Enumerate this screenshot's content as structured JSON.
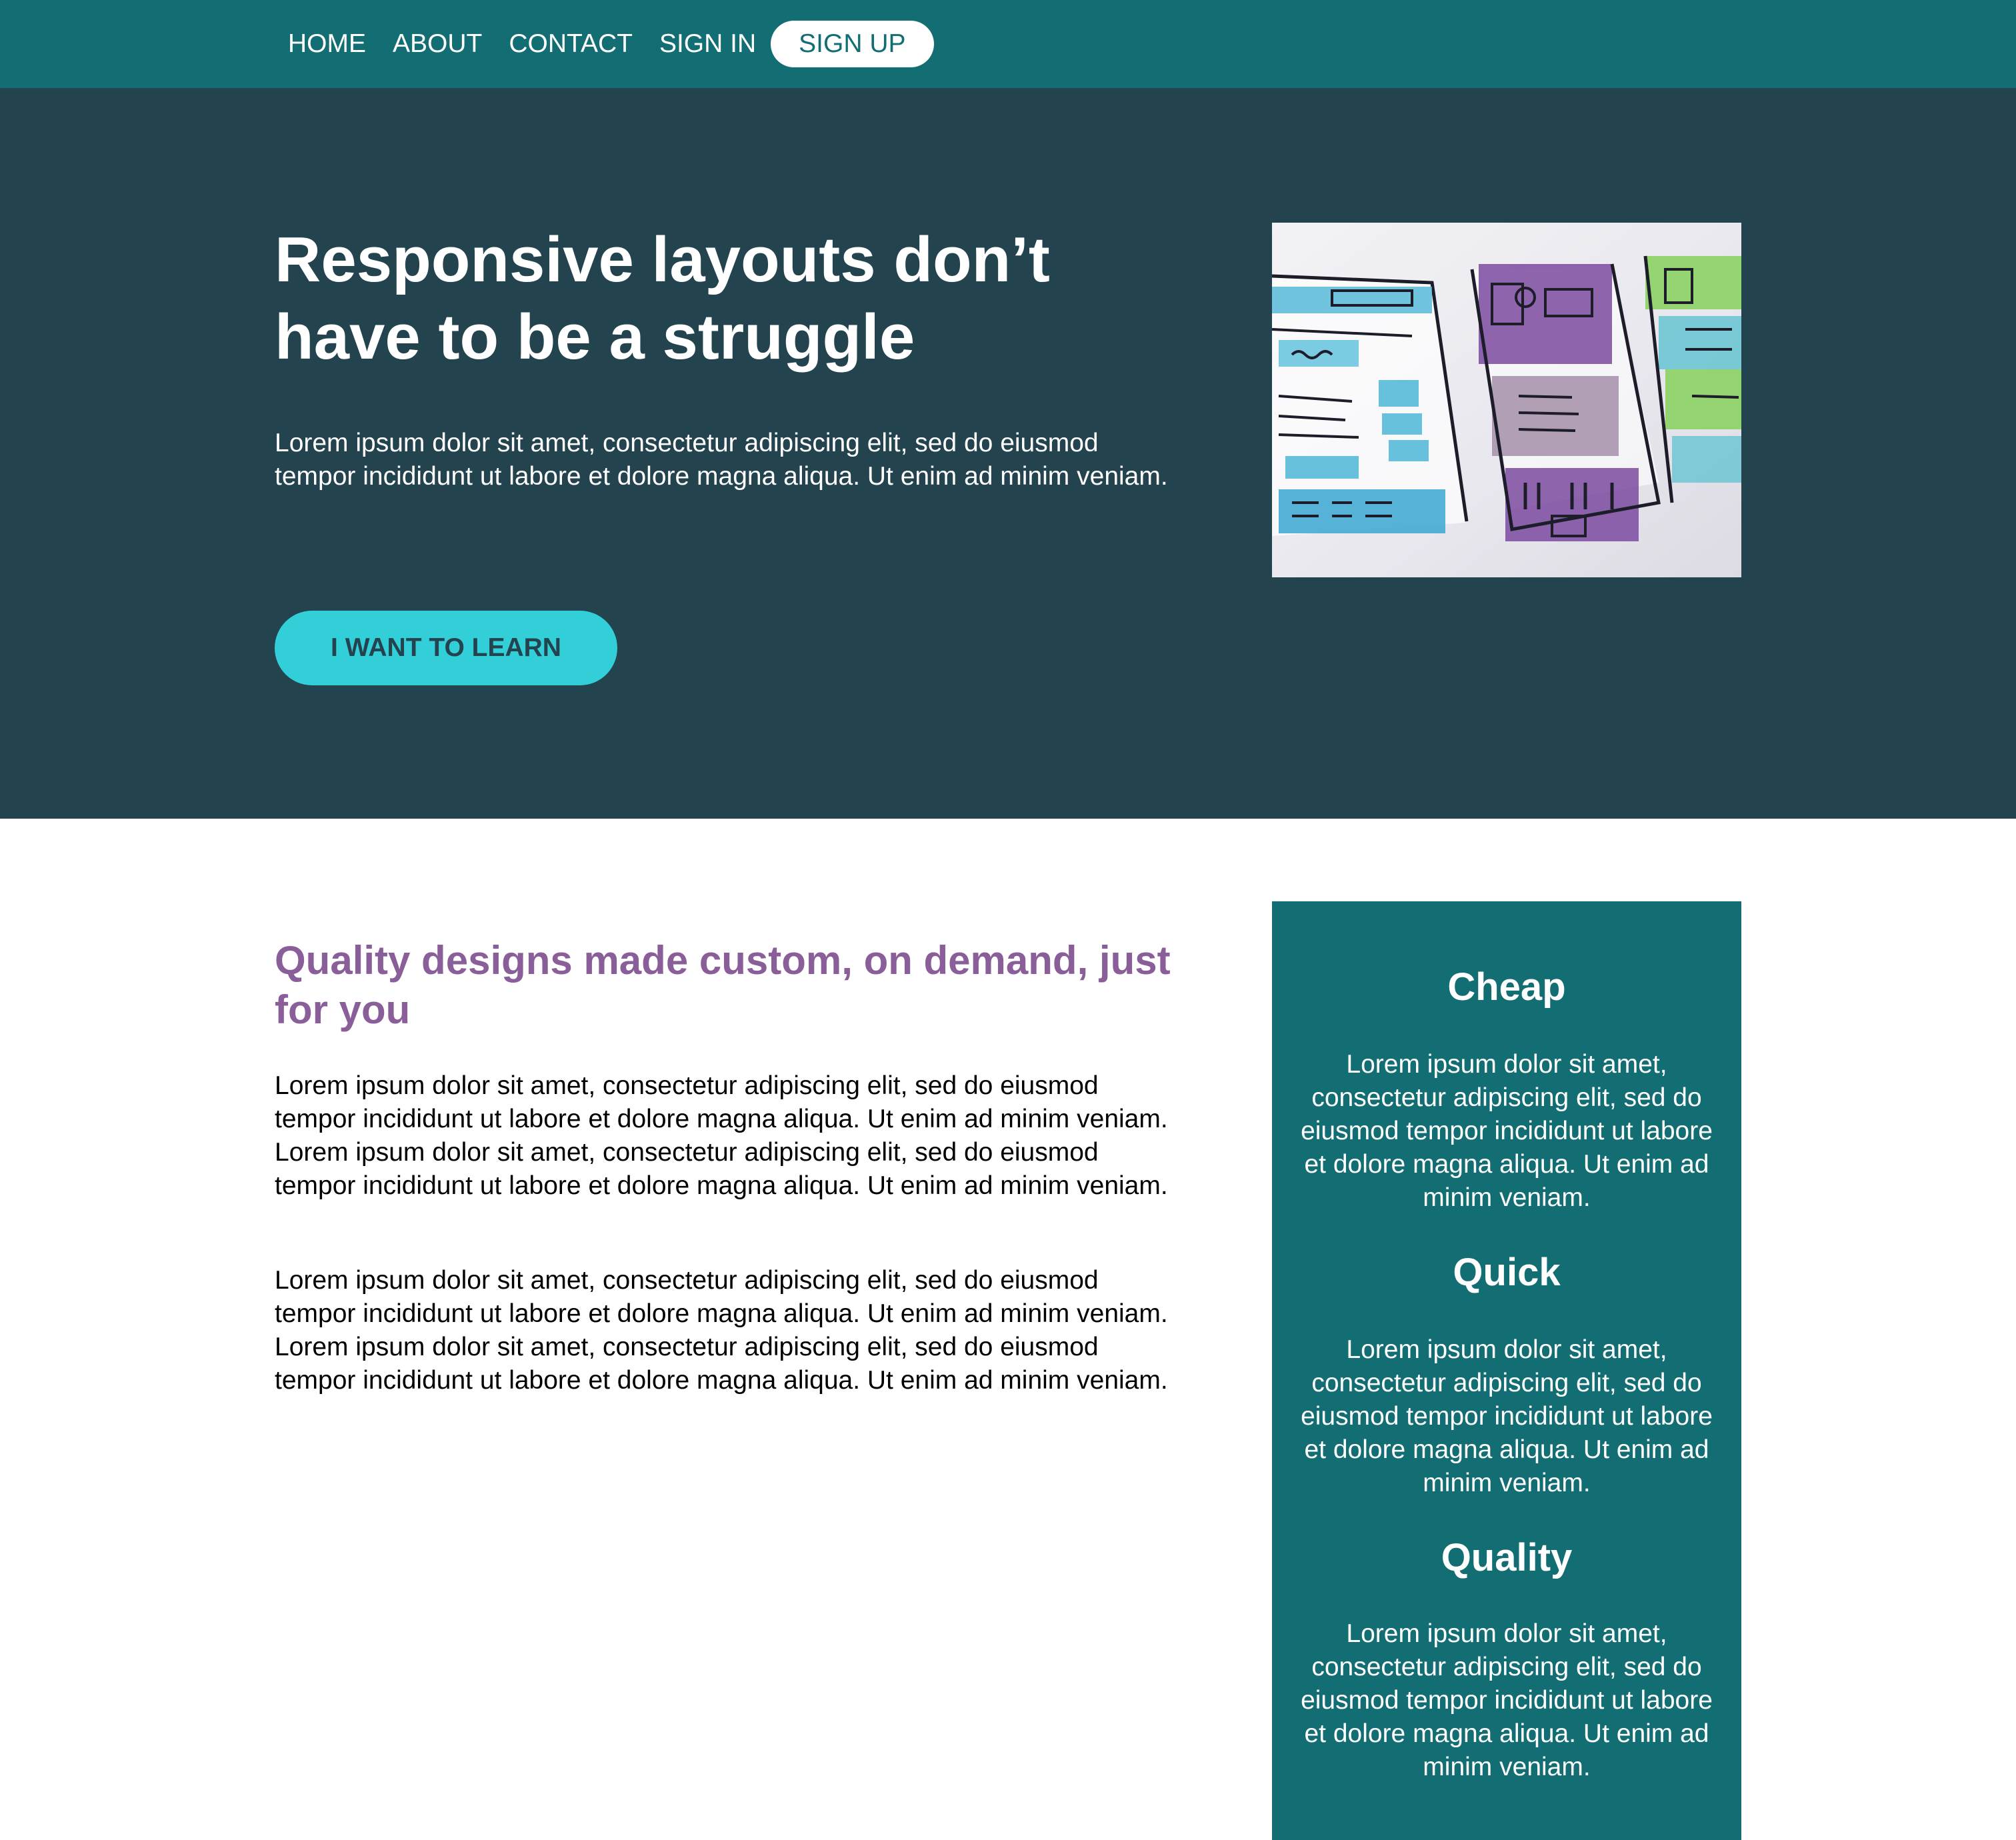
{
  "nav": {
    "items": [
      {
        "label": "HOME"
      },
      {
        "label": "ABOUT"
      },
      {
        "label": "CONTACT"
      },
      {
        "label": "SIGN IN"
      }
    ],
    "signup_label": "SIGN UP"
  },
  "hero": {
    "title": "Responsive layouts don’t have to be a struggle",
    "text": "Lorem ipsum dolor sit amet, consectetur adipiscing elit, sed do eiusmod tempor incididunt ut labore et dolore magna aliqua. Ut enim ad minim veniam.",
    "button_label": "I WANT TO LEARN"
  },
  "main": {
    "heading": "Quality designs made custom, on demand, just for you",
    "paragraphs": [
      "Lorem ipsum dolor sit amet, consectetur adipiscing elit, sed do eiusmod tempor incididunt ut labore et dolore magna aliqua. Ut enim ad minim veniam. Lorem ipsum dolor sit amet, consectetur adipiscing elit, sed do eiusmod tempor incididunt ut labore et dolore magna aliqua. Ut enim ad minim veniam.",
      "Lorem ipsum dolor sit amet, consectetur adipiscing elit, sed do eiusmod tempor incididunt ut labore et dolore magna aliqua. Ut enim ad minim veniam. Lorem ipsum dolor sit amet, consectetur adipiscing elit, sed do eiusmod tempor incididunt ut labore et dolore magna aliqua. Ut enim ad minim veniam."
    ]
  },
  "sidebar": {
    "features": [
      {
        "title": "Cheap",
        "text": "Lorem ipsum dolor sit amet, consectetur adipiscing elit, sed do eiusmod tempor incididunt ut labore et dolore magna aliqua. Ut enim ad minim veniam."
      },
      {
        "title": "Quick",
        "text": "Lorem ipsum dolor sit amet, consectetur adipiscing elit, sed do eiusmod tempor incididunt ut labore et dolore magna aliqua. Ut enim ad minim veniam."
      },
      {
        "title": "Quality",
        "text": "Lorem ipsum dolor sit amet, consectetur adipiscing elit, sed do eiusmod tempor incididunt ut labore et dolore magna aliqua. Ut enim ad minim veniam."
      }
    ]
  },
  "colors": {
    "nav_bg": "#136e74",
    "hero_bg": "#23434e",
    "accent_button": "#33cfd8",
    "heading_purple": "#8a5e99",
    "sidebar_bg": "#136e74"
  },
  "icons": {
    "hero_image": "wireframe-sketch-image"
  }
}
